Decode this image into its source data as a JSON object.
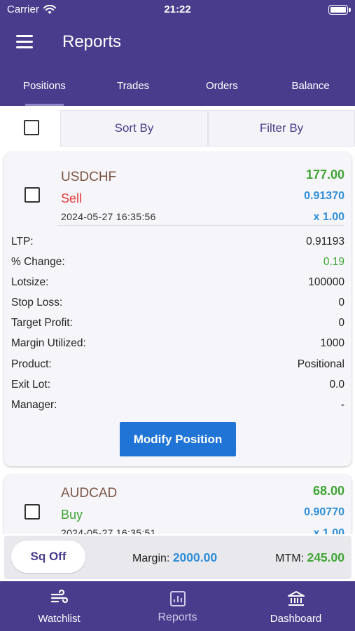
{
  "status_bar": {
    "carrier": "Carrier",
    "time": "21:22"
  },
  "header": {
    "title": "Reports"
  },
  "tabs": [
    {
      "label": "Positions",
      "active": true
    },
    {
      "label": "Trades",
      "active": false
    },
    {
      "label": "Orders",
      "active": false
    },
    {
      "label": "Balance",
      "active": false
    }
  ],
  "toolbar": {
    "sort_label": "Sort By",
    "filter_label": "Filter By"
  },
  "positions": [
    {
      "symbol": "USDCHF",
      "side": "Sell",
      "datetime": "2024-05-27 16:35:56",
      "pnl": "177.00",
      "price": "0.91370",
      "lots": "x 1.00",
      "details": [
        {
          "label": "LTP:",
          "value": "0.91193"
        },
        {
          "label": "% Change:",
          "value": "0.19"
        },
        {
          "label": "Lotsize:",
          "value": "100000"
        },
        {
          "label": "Stop Loss:",
          "value": "0"
        },
        {
          "label": "Target Profit:",
          "value": "0"
        },
        {
          "label": "Margin Utilized:",
          "value": "1000"
        },
        {
          "label": "Product:",
          "value": "Positional"
        },
        {
          "label": "Exit Lot:",
          "value": "0.0"
        },
        {
          "label": "Manager:",
          "value": "-"
        }
      ],
      "modify_label": "Modify Position"
    },
    {
      "symbol": "AUDCAD",
      "side": "Buy",
      "datetime": "2024-05-27 16:35:51",
      "pnl": "68.00",
      "price": "0.90770",
      "lots": "x 1.00"
    }
  ],
  "summary": {
    "sqoff_label": "Sq Off",
    "margin_label": "Margin:",
    "margin_value": "2000.00",
    "mtm_label": "MTM:",
    "mtm_value": "245.00"
  },
  "bottom_nav": [
    {
      "label": "Watchlist",
      "icon": "wind-icon",
      "active": false
    },
    {
      "label": "Reports",
      "icon": "report-chart-icon",
      "active": true
    },
    {
      "label": "Dashboard",
      "icon": "bank-icon",
      "active": false
    }
  ],
  "colors": {
    "brand": "#4a3c8c",
    "sell": "#e53935",
    "buy": "#3fa535",
    "price": "#2f8fd8",
    "button": "#1f74d6"
  }
}
